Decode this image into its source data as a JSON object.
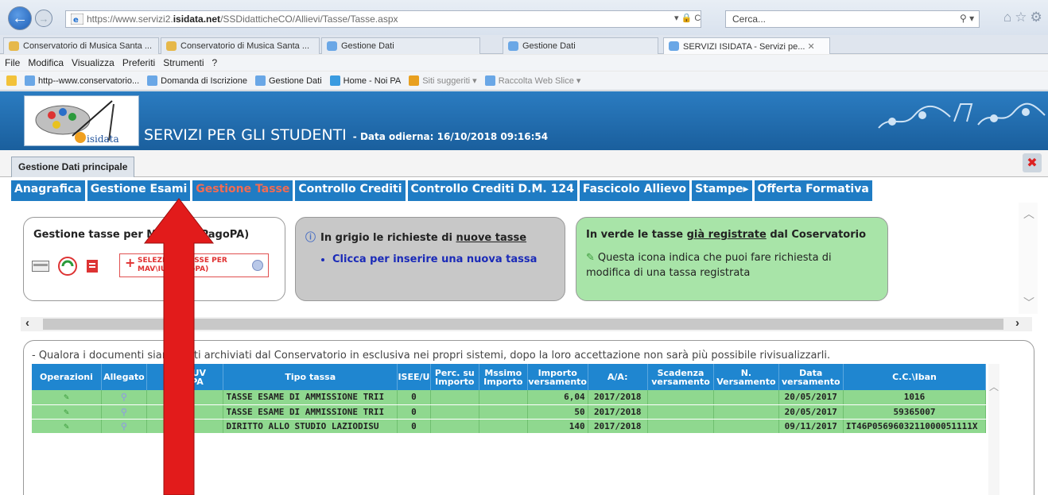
{
  "browser": {
    "url_prefix": "https://www.servizi2.",
    "url_host": "isidata.net",
    "url_path": "/SSDidatticheCO/Allievi/Tasse/Tasse.aspx",
    "url_controls": "▾ 🔒 C",
    "search_placeholder": "Cerca...",
    "search_controls": "⚲ ▾",
    "tabs": [
      {
        "label": "Conservatorio di Musica Santa ..."
      },
      {
        "label": "Conservatorio di Musica Santa ..."
      },
      {
        "label": "Gestione Dati"
      },
      {
        "label": "Gestione Dati"
      },
      {
        "label": "SERVIZI ISIDATA - Servizi pe..."
      }
    ],
    "tab_close": "✕",
    "menu": [
      "File",
      "Modifica",
      "Visualizza",
      "Preferiti",
      "Strumenti",
      "?"
    ],
    "favorites": [
      {
        "label": "http--www.conservatorio..."
      },
      {
        "label": "Domanda di Iscrizione"
      },
      {
        "label": "Gestione Dati"
      },
      {
        "label": "Home - Noi PA"
      },
      {
        "label": "Siti suggeriti ▾"
      },
      {
        "label": "Raccolta Web Slice ▾"
      }
    ],
    "colors": {
      "accent": "#1f5fb5"
    }
  },
  "banner": {
    "logo_text": "isidata",
    "title": "SERVIZI PER GLI STUDENTI",
    "date": "- Data odierna: 16/10/2018 09:16:54"
  },
  "section": {
    "tab_label": "Gestione Dati principale"
  },
  "nav": {
    "items": [
      "Anagrafica",
      "Gestione Esami",
      "Gestione Tasse",
      "Controllo Crediti",
      "Controllo Crediti D.M. 124",
      "Fascicolo Allievo",
      "Stampe",
      "Offerta Formativa"
    ],
    "stampe_arrow": "▸"
  },
  "box_mav": {
    "title": "Gestione tasse per MAV\\IUV(PagoPA)",
    "button_line1": "SELEZIONE TASSE PER",
    "button_line2": "MAV\\IUV(PagoPA)"
  },
  "box_gray": {
    "title_prefix": "In grigio le richieste di ",
    "title_link": "nuove tasse",
    "bullet": "Clicca per inserire una nuova tassa"
  },
  "box_green": {
    "title_prefix": "In verde le tasse ",
    "title_link": "già registrate",
    "title_suffix": " dal Coservatorio",
    "desc": "Questa icona indica che puoi fare richiesta di modifica di una tassa registrata"
  },
  "notice": "- Qualora i documenti siano stati archiviati dal Conservatorio in esclusiva nei propri sistemi, dopo la loro accettazione non sarà più possibile rivisualizzarli.",
  "table": {
    "headers": [
      "Operazioni",
      "Allegato",
      "MAV\\IUV PagoPA",
      "Tipo tassa",
      "ISEE/U",
      "Perc. su Importo",
      "Mssimo Importo",
      "Importo versamento",
      "A/A:",
      "Scadenza versamento",
      "N. Versamento",
      "Data versamento",
      "C.C.\\Iban"
    ],
    "rows": [
      {
        "tipo": "TASSE ESAME DI AMMISSIONE TRII",
        "isee": "0",
        "importo": "6,04",
        "aa": "2017/2018",
        "data": "20/05/2017",
        "iban": "1016"
      },
      {
        "tipo": "TASSE ESAME DI AMMISSIONE TRII",
        "isee": "0",
        "importo": "50",
        "aa": "2017/2018",
        "data": "20/05/2017",
        "iban": "59365007"
      },
      {
        "tipo": "DIRITTO ALLO STUDIO LAZIODISU",
        "isee": "0",
        "importo": "140",
        "aa": "2017/2018",
        "data": "09/11/2017",
        "iban": "IT46P0569603211000051111X"
      }
    ],
    "row_color": "#8fd88f",
    "header_color": "#1f86d0"
  },
  "annotation": {
    "arrow_color": "#e21b1b"
  }
}
